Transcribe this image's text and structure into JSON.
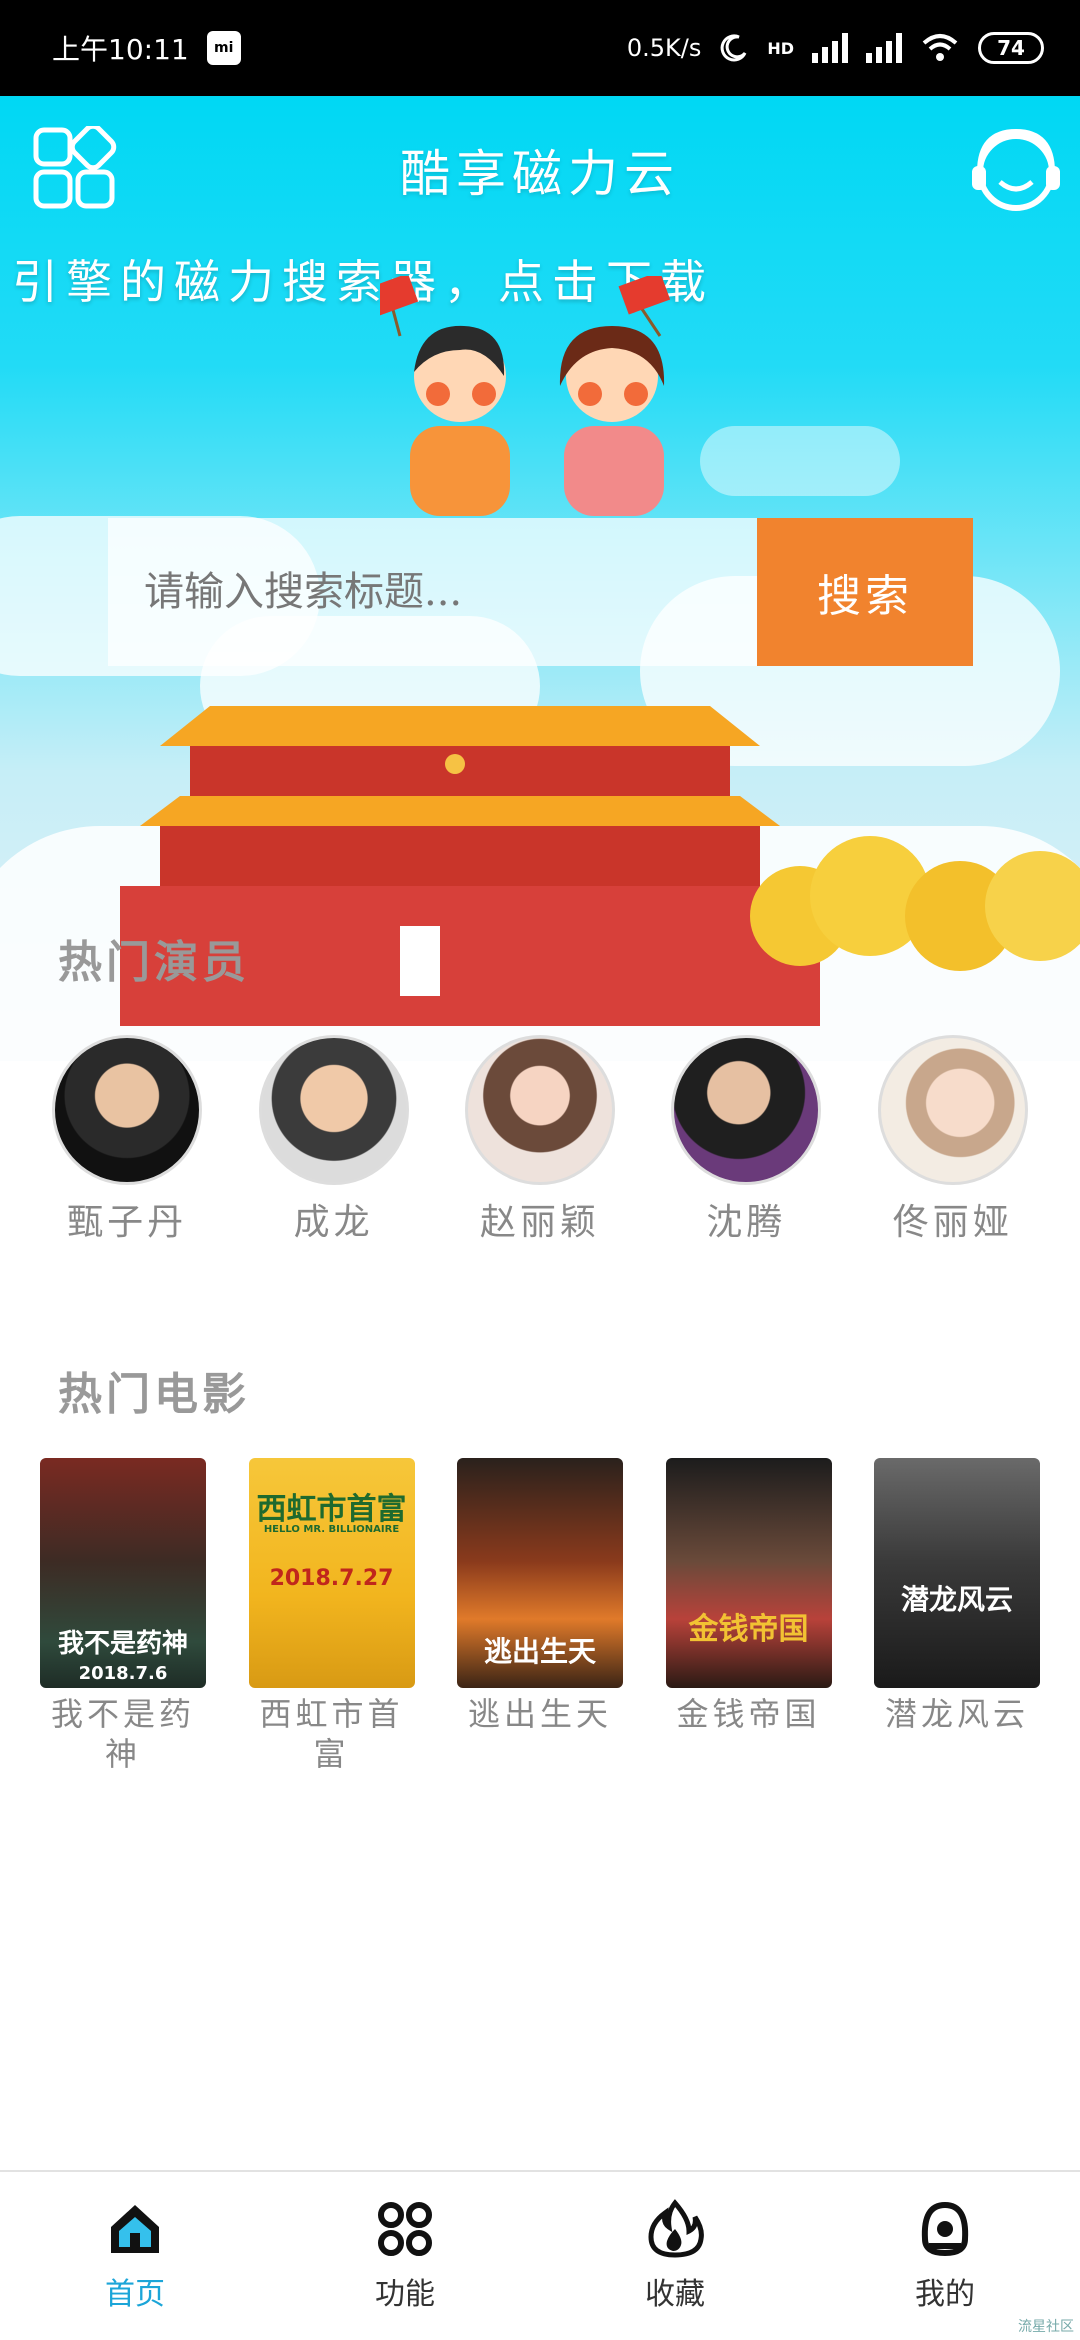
{
  "status_bar": {
    "time": "上午10:11",
    "app_badge": "mi",
    "net_speed": "0.5K/s",
    "network_type": "HD",
    "battery": "74"
  },
  "header": {
    "title": "酷享磁力云",
    "marquee": "引擎的磁力搜索器，点击下载"
  },
  "search": {
    "placeholder": "请输入搜索标题...",
    "button_label": "搜索"
  },
  "actors_section": {
    "title": "热门演员",
    "items": [
      {
        "name": "甄子丹"
      },
      {
        "name": "成龙"
      },
      {
        "name": "赵丽颖"
      },
      {
        "name": "沈腾"
      },
      {
        "name": "佟丽娅"
      }
    ]
  },
  "movies_section": {
    "title": "热门电影",
    "items": [
      {
        "title": "我不是药神",
        "poster_date": "2018.7.6",
        "poster_caption": "我不是药神"
      },
      {
        "title": "西虹市首富",
        "poster_date": "2018.7.27",
        "poster_caption": "西虹市首富",
        "poster_sub": "HELLO MR. BILLIONAIRE"
      },
      {
        "title": "逃出生天",
        "poster_caption": "逃出生天"
      },
      {
        "title": "金钱帝国",
        "poster_caption": "金钱帝国"
      },
      {
        "title": "潜龙风云",
        "poster_caption": "潜龙风云"
      }
    ]
  },
  "bottom_nav": {
    "items": [
      {
        "label": "首页",
        "icon": "home-icon",
        "active": true
      },
      {
        "label": "功能",
        "icon": "grid-icon",
        "active": false
      },
      {
        "label": "收藏",
        "icon": "flame-icon",
        "active": false
      },
      {
        "label": "我的",
        "icon": "profile-icon",
        "active": false
      }
    ]
  },
  "watermark": "流星社区",
  "colors": {
    "hero_top": "#00d8f4",
    "search_button": "#f1832e",
    "nav_active": "#1ba5d8"
  }
}
